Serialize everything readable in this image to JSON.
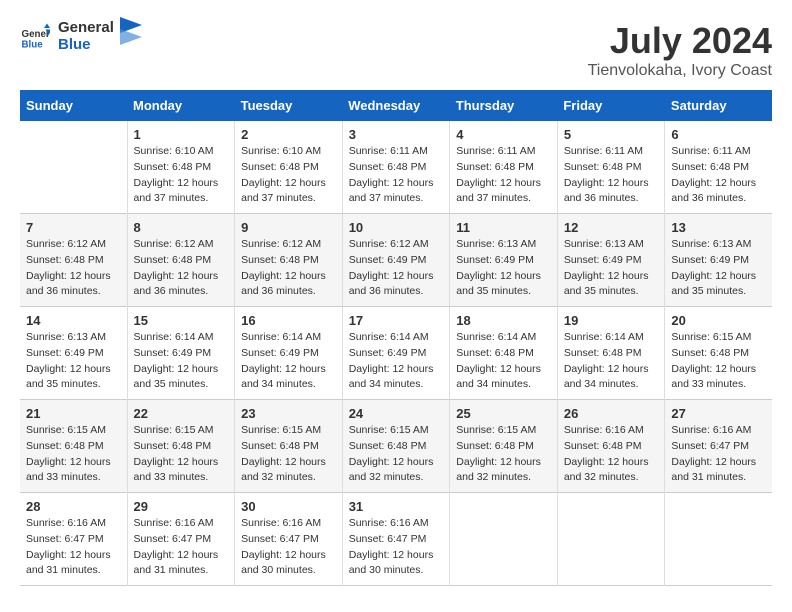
{
  "header": {
    "logo_general": "General",
    "logo_blue": "Blue",
    "month": "July 2024",
    "location": "Tienvolokaha, Ivory Coast"
  },
  "weekdays": [
    "Sunday",
    "Monday",
    "Tuesday",
    "Wednesday",
    "Thursday",
    "Friday",
    "Saturday"
  ],
  "weeks": [
    [
      {
        "day": "",
        "sunrise": "",
        "sunset": "",
        "daylight": ""
      },
      {
        "day": "1",
        "sunrise": "Sunrise: 6:10 AM",
        "sunset": "Sunset: 6:48 PM",
        "daylight": "Daylight: 12 hours and 37 minutes."
      },
      {
        "day": "2",
        "sunrise": "Sunrise: 6:10 AM",
        "sunset": "Sunset: 6:48 PM",
        "daylight": "Daylight: 12 hours and 37 minutes."
      },
      {
        "day": "3",
        "sunrise": "Sunrise: 6:11 AM",
        "sunset": "Sunset: 6:48 PM",
        "daylight": "Daylight: 12 hours and 37 minutes."
      },
      {
        "day": "4",
        "sunrise": "Sunrise: 6:11 AM",
        "sunset": "Sunset: 6:48 PM",
        "daylight": "Daylight: 12 hours and 37 minutes."
      },
      {
        "day": "5",
        "sunrise": "Sunrise: 6:11 AM",
        "sunset": "Sunset: 6:48 PM",
        "daylight": "Daylight: 12 hours and 36 minutes."
      },
      {
        "day": "6",
        "sunrise": "Sunrise: 6:11 AM",
        "sunset": "Sunset: 6:48 PM",
        "daylight": "Daylight: 12 hours and 36 minutes."
      }
    ],
    [
      {
        "day": "7",
        "sunrise": "Sunrise: 6:12 AM",
        "sunset": "Sunset: 6:48 PM",
        "daylight": "Daylight: 12 hours and 36 minutes."
      },
      {
        "day": "8",
        "sunrise": "Sunrise: 6:12 AM",
        "sunset": "Sunset: 6:48 PM",
        "daylight": "Daylight: 12 hours and 36 minutes."
      },
      {
        "day": "9",
        "sunrise": "Sunrise: 6:12 AM",
        "sunset": "Sunset: 6:48 PM",
        "daylight": "Daylight: 12 hours and 36 minutes."
      },
      {
        "day": "10",
        "sunrise": "Sunrise: 6:12 AM",
        "sunset": "Sunset: 6:49 PM",
        "daylight": "Daylight: 12 hours and 36 minutes."
      },
      {
        "day": "11",
        "sunrise": "Sunrise: 6:13 AM",
        "sunset": "Sunset: 6:49 PM",
        "daylight": "Daylight: 12 hours and 35 minutes."
      },
      {
        "day": "12",
        "sunrise": "Sunrise: 6:13 AM",
        "sunset": "Sunset: 6:49 PM",
        "daylight": "Daylight: 12 hours and 35 minutes."
      },
      {
        "day": "13",
        "sunrise": "Sunrise: 6:13 AM",
        "sunset": "Sunset: 6:49 PM",
        "daylight": "Daylight: 12 hours and 35 minutes."
      }
    ],
    [
      {
        "day": "14",
        "sunrise": "Sunrise: 6:13 AM",
        "sunset": "Sunset: 6:49 PM",
        "daylight": "Daylight: 12 hours and 35 minutes."
      },
      {
        "day": "15",
        "sunrise": "Sunrise: 6:14 AM",
        "sunset": "Sunset: 6:49 PM",
        "daylight": "Daylight: 12 hours and 35 minutes."
      },
      {
        "day": "16",
        "sunrise": "Sunrise: 6:14 AM",
        "sunset": "Sunset: 6:49 PM",
        "daylight": "Daylight: 12 hours and 34 minutes."
      },
      {
        "day": "17",
        "sunrise": "Sunrise: 6:14 AM",
        "sunset": "Sunset: 6:49 PM",
        "daylight": "Daylight: 12 hours and 34 minutes."
      },
      {
        "day": "18",
        "sunrise": "Sunrise: 6:14 AM",
        "sunset": "Sunset: 6:48 PM",
        "daylight": "Daylight: 12 hours and 34 minutes."
      },
      {
        "day": "19",
        "sunrise": "Sunrise: 6:14 AM",
        "sunset": "Sunset: 6:48 PM",
        "daylight": "Daylight: 12 hours and 34 minutes."
      },
      {
        "day": "20",
        "sunrise": "Sunrise: 6:15 AM",
        "sunset": "Sunset: 6:48 PM",
        "daylight": "Daylight: 12 hours and 33 minutes."
      }
    ],
    [
      {
        "day": "21",
        "sunrise": "Sunrise: 6:15 AM",
        "sunset": "Sunset: 6:48 PM",
        "daylight": "Daylight: 12 hours and 33 minutes."
      },
      {
        "day": "22",
        "sunrise": "Sunrise: 6:15 AM",
        "sunset": "Sunset: 6:48 PM",
        "daylight": "Daylight: 12 hours and 33 minutes."
      },
      {
        "day": "23",
        "sunrise": "Sunrise: 6:15 AM",
        "sunset": "Sunset: 6:48 PM",
        "daylight": "Daylight: 12 hours and 32 minutes."
      },
      {
        "day": "24",
        "sunrise": "Sunrise: 6:15 AM",
        "sunset": "Sunset: 6:48 PM",
        "daylight": "Daylight: 12 hours and 32 minutes."
      },
      {
        "day": "25",
        "sunrise": "Sunrise: 6:15 AM",
        "sunset": "Sunset: 6:48 PM",
        "daylight": "Daylight: 12 hours and 32 minutes."
      },
      {
        "day": "26",
        "sunrise": "Sunrise: 6:16 AM",
        "sunset": "Sunset: 6:48 PM",
        "daylight": "Daylight: 12 hours and 32 minutes."
      },
      {
        "day": "27",
        "sunrise": "Sunrise: 6:16 AM",
        "sunset": "Sunset: 6:47 PM",
        "daylight": "Daylight: 12 hours and 31 minutes."
      }
    ],
    [
      {
        "day": "28",
        "sunrise": "Sunrise: 6:16 AM",
        "sunset": "Sunset: 6:47 PM",
        "daylight": "Daylight: 12 hours and 31 minutes."
      },
      {
        "day": "29",
        "sunrise": "Sunrise: 6:16 AM",
        "sunset": "Sunset: 6:47 PM",
        "daylight": "Daylight: 12 hours and 31 minutes."
      },
      {
        "day": "30",
        "sunrise": "Sunrise: 6:16 AM",
        "sunset": "Sunset: 6:47 PM",
        "daylight": "Daylight: 12 hours and 30 minutes."
      },
      {
        "day": "31",
        "sunrise": "Sunrise: 6:16 AM",
        "sunset": "Sunset: 6:47 PM",
        "daylight": "Daylight: 12 hours and 30 minutes."
      },
      {
        "day": "",
        "sunrise": "",
        "sunset": "",
        "daylight": ""
      },
      {
        "day": "",
        "sunrise": "",
        "sunset": "",
        "daylight": ""
      },
      {
        "day": "",
        "sunrise": "",
        "sunset": "",
        "daylight": ""
      }
    ]
  ]
}
